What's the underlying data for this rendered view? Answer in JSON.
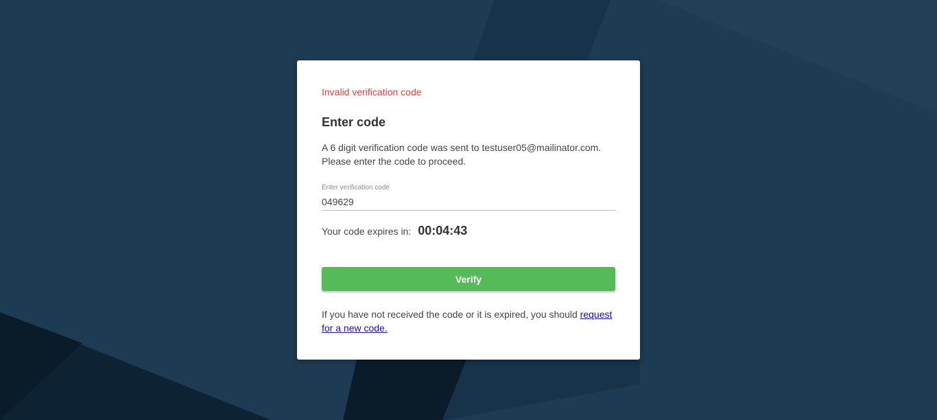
{
  "error": {
    "text": "Invalid verification code",
    "color": "#e2403b"
  },
  "heading": "Enter code",
  "description": {
    "line1": "A 6 digit verification code was sent to testuser05@mailinator.com.",
    "line2": "Please enter the code to proceed."
  },
  "code_field": {
    "label": "Enter verification code",
    "value": "049629"
  },
  "expiry": {
    "label": "Your code expires in:",
    "timer": "00:04:43"
  },
  "verify_button": {
    "label": "Verify",
    "color": "#55ba58"
  },
  "footer": {
    "text": "If you have not received the code or it is expired, you should ",
    "link_text": "request for a new code."
  },
  "colors": {
    "background": "#1d3b53",
    "card": "#ffffff",
    "link": "#1a0dab"
  }
}
